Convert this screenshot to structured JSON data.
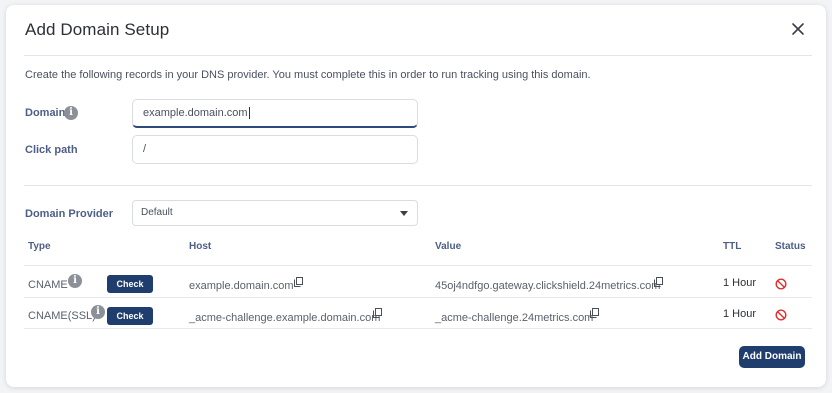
{
  "modal": {
    "title": "Add Domain Setup",
    "description": "Create the following records in your DNS provider. You must complete this in order to run tracking using this domain."
  },
  "form": {
    "domain_label": "Domain",
    "domain_value": "example.domain.com",
    "click_path_label": "Click path",
    "click_path_value": "/",
    "provider_label": "Domain Provider",
    "provider_value": "Default"
  },
  "table": {
    "headers": {
      "type": "Type",
      "host": "Host",
      "value": "Value",
      "ttl": "TTL",
      "status": "Status"
    },
    "rows": [
      {
        "type": "CNAME",
        "check": "Check",
        "host": "example.domain.com",
        "value": "45oj4ndfgo.gateway.clickshield.24metrics.com",
        "ttl": "1 Hour",
        "status_icon": "blocked-icon"
      },
      {
        "type": "CNAME(SSL)",
        "check": "Check",
        "host": "_acme-challenge.example.domain.com",
        "value": "_acme-challenge.24metrics.com",
        "ttl": "1 Hour",
        "status_icon": "blocked-icon"
      }
    ]
  },
  "footer": {
    "add_domain": "Add Domain"
  },
  "colors": {
    "primary": "#1f3d6d",
    "label": "#4d5e86",
    "status_error": "#e0302f"
  }
}
